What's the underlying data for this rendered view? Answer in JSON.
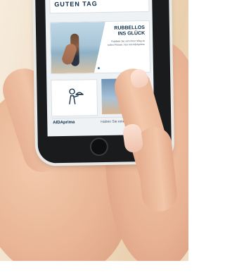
{
  "app_screen": {
    "greeting": "GUTEN TAG",
    "banner": {
      "title_line1": "RUBBELLOS",
      "title_line2": "INS GLÜCK",
      "subtitle": "Rubbeln Sie sich Ihren Weg zu tollen Preisen. Nur mit AIDAprima."
    },
    "footer": {
      "brand": "AIDAprima",
      "question": "Haben Sie eine Frage?"
    }
  },
  "colors": {
    "navy": "#0d2b45",
    "accent": "#3a7fb8"
  },
  "icons": [
    "waiter-tray-icon",
    "ferris-wheel-icon"
  ]
}
